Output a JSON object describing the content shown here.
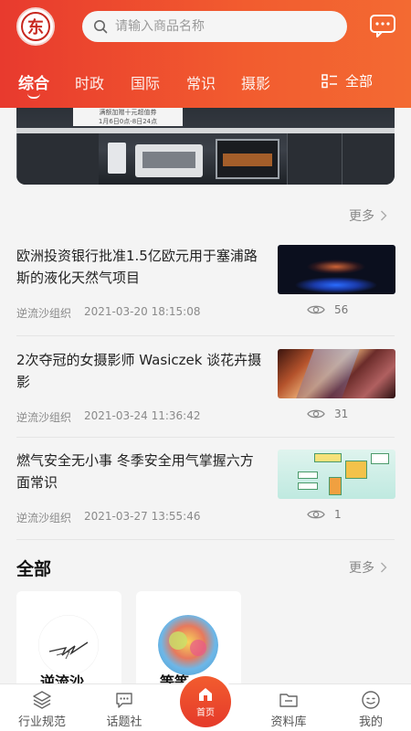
{
  "header": {
    "logo_text": "东",
    "search_placeholder": "请输入商品名称",
    "message_icon": "chat-bubble-icon"
  },
  "tabs": [
    {
      "label": "综合",
      "active": true
    },
    {
      "label": "时政",
      "active": false
    },
    {
      "label": "国际",
      "active": false
    },
    {
      "label": "常识",
      "active": false
    },
    {
      "label": "摄影",
      "active": false
    }
  ],
  "tab_all_label": "全部",
  "banner": {
    "promo_line1": "满额加赠十元超值券",
    "promo_line2": "1月6日0点-8日24点"
  },
  "news_section": {
    "more_label": "更多"
  },
  "news": [
    {
      "title": "欧洲投资银行批准1.5亿欧元用于塞浦路斯的液化天然气项目",
      "source": "逆流沙组织",
      "date": "2021-03-20 18:15:08",
      "views": "56"
    },
    {
      "title": "2次夺冠的女摄影师 Wasiczek 谈花卉摄影",
      "source": "逆流沙组织",
      "date": "2021-03-24 11:36:42",
      "views": "31"
    },
    {
      "title": "燃气安全无小事 冬季安全用气掌握六方面常识",
      "source": "逆流沙组织",
      "date": "2021-03-27 13:55:46",
      "views": "1"
    }
  ],
  "all_section": {
    "title": "全部",
    "more_label": "更多",
    "cards": [
      {
        "name": "逆流沙..."
      },
      {
        "name": "等等..."
      }
    ]
  },
  "bottom_nav": {
    "items": [
      {
        "label": "行业规范",
        "icon": "layers-icon"
      },
      {
        "label": "话题社",
        "icon": "chat-dots-icon"
      },
      {
        "label": "首页",
        "icon": "home-icon"
      },
      {
        "label": "资料库",
        "icon": "folder-icon"
      },
      {
        "label": "我的",
        "icon": "smile-face-icon"
      }
    ]
  },
  "colors": {
    "brand": "#ee4a2e",
    "text": "#222222",
    "muted": "#8a8a8a"
  }
}
